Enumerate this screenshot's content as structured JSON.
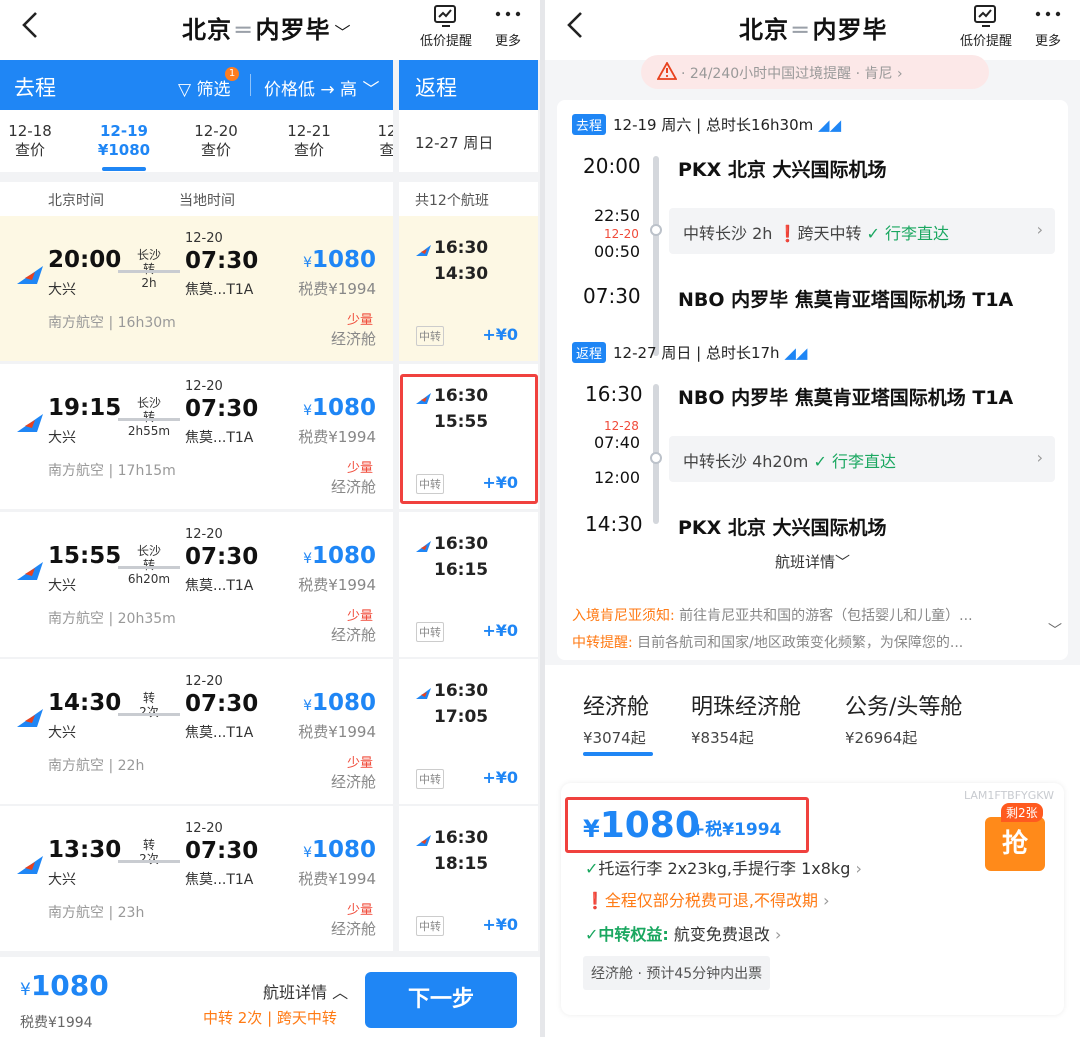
{
  "left": {
    "title_from": "北京",
    "title_to": "内罗毕",
    "btn_alert": "低价提醒",
    "btn_more": "更多",
    "outbound_label": "去程",
    "filter_label": "筛选",
    "filter_count": "1",
    "sort_label": "价格低 → 高",
    "return_label": "返程",
    "dates": [
      {
        "date": "12-18",
        "sub": "查价"
      },
      {
        "date": "12-19",
        "sub": "¥1080"
      },
      {
        "date": "12-20",
        "sub": "查价"
      },
      {
        "date": "12-21",
        "sub": "查价"
      },
      {
        "date": "12",
        "sub": "查"
      }
    ],
    "return_date": "12-27 周日",
    "col_beijing": "北京时间",
    "col_local": "当地时间",
    "return_count": "共12个航班",
    "flights": [
      {
        "dep": "20:00",
        "dep_ap": "大兴",
        "via": "长沙",
        "via2": "转",
        "dur": "2h",
        "arr_date": "12-20",
        "arr": "07:30",
        "arr_ap": "焦莫...T1A",
        "price": "1080",
        "tax": "税费¥1994",
        "airline": "南方航空",
        "total": "16h30m",
        "seat": "少量",
        "cabin": "经济舱",
        "r_dep": "16:30",
        "r_arr": "14:30",
        "r_tag": "中转",
        "r_add": "+¥0"
      },
      {
        "dep": "19:15",
        "dep_ap": "大兴",
        "via": "长沙",
        "via2": "转",
        "dur": "2h55m",
        "arr_date": "12-20",
        "arr": "07:30",
        "arr_ap": "焦莫...T1A",
        "price": "1080",
        "tax": "税费¥1994",
        "airline": "南方航空",
        "total": "17h15m",
        "seat": "少量",
        "cabin": "经济舱",
        "r_dep": "16:30",
        "r_arr": "15:55",
        "r_tag": "中转",
        "r_add": "+¥0"
      },
      {
        "dep": "15:55",
        "dep_ap": "大兴",
        "via": "长沙",
        "via2": "转",
        "dur": "6h20m",
        "arr_date": "12-20",
        "arr": "07:30",
        "arr_ap": "焦莫...T1A",
        "price": "1080",
        "tax": "税费¥1994",
        "airline": "南方航空",
        "total": "20h35m",
        "seat": "少量",
        "cabin": "经济舱",
        "r_dep": "16:30",
        "r_arr": "16:15",
        "r_tag": "中转",
        "r_add": "+¥0"
      },
      {
        "dep": "14:30",
        "dep_ap": "大兴",
        "via": "",
        "via2": "转",
        "dur": "2次",
        "arr_date": "12-20",
        "arr": "07:30",
        "arr_ap": "焦莫...T1A",
        "price": "1080",
        "tax": "税费¥1994",
        "airline": "南方航空",
        "total": "22h",
        "seat": "少量",
        "cabin": "经济舱",
        "r_dep": "16:30",
        "r_arr": "17:05",
        "r_tag": "中转",
        "r_add": "+¥0"
      },
      {
        "dep": "13:30",
        "dep_ap": "大兴",
        "via": "",
        "via2": "转",
        "dur": "2次",
        "arr_date": "12-20",
        "arr": "07:30",
        "arr_ap": "焦莫...T1A",
        "price": "1080",
        "tax": "税费¥1994",
        "airline": "南方航空",
        "total": "23h",
        "seat": "少量",
        "cabin": "经济舱",
        "r_dep": "16:30",
        "r_arr": "18:15",
        "r_tag": "中转",
        "r_add": "+¥0"
      }
    ],
    "bottom_price": "1080",
    "bottom_tax": "税费¥1994",
    "bottom_detail": "航班详情",
    "bottom_meta": "中转 2次 | 跨天中转",
    "next_btn": "下一步"
  },
  "right": {
    "title_from": "北京",
    "title_to": "内罗毕",
    "btn_alert": "低价提醒",
    "btn_more": "更多",
    "notice": "· 24/240小时中国过境提醒 · 肯尼",
    "out_tag": "去程",
    "out_hdr": "12-19 周六 | 总时长16h30m",
    "out_dep": "20:00",
    "out_dep_ap": "PKX 北京 大兴国际机场",
    "out_t1": "22:50",
    "out_tdate": "12-20",
    "out_t2": "00:50",
    "out_transfer_a": "中转长沙 2h",
    "out_transfer_b": "跨天中转",
    "out_transfer_c": "行李直达",
    "out_arr": "07:30",
    "out_arr_ap": "NBO 内罗毕 焦莫肯亚塔国际机场 T1A",
    "ret_tag": "返程",
    "ret_hdr": "12-27 周日 | 总时长17h",
    "ret_dep": "16:30",
    "ret_dep_ap": "NBO 内罗毕 焦莫肯亚塔国际机场 T1A",
    "ret_tdate": "12-28",
    "ret_t1": "07:40",
    "ret_t2": "12:00",
    "ret_transfer_a": "中转长沙 4h20m",
    "ret_transfer_c": "行李直达",
    "ret_arr": "14:30",
    "ret_arr_ap": "PKX 北京 大兴国际机场",
    "flight_detail": "航班详情",
    "note1_key": "入境肯尼亚须知:",
    "note1": "前往肯尼亚共和国的游客（包括婴儿和儿童）...",
    "note2_key": "中转提醒:",
    "note2": "目前各航司和国家/地区政策变化频繁，为保障您的...",
    "cabins": [
      {
        "name": "经济舱",
        "price": "¥3074起"
      },
      {
        "name": "明珠经济舱",
        "price": "¥8354起"
      },
      {
        "name": "公务/头等舱",
        "price": "¥26964起"
      }
    ],
    "fare_code": "LAM1FTBFYGKW",
    "fare_price": "1080",
    "fare_tax": "+税¥1994",
    "grab_tag": "剩2张",
    "grab": "抢",
    "line1": "托运行李 2x23kg,手提行李 1x8kg",
    "line2": "全程仅部分税费可退,不得改期",
    "line3_key": "中转权益:",
    "line3": "航变免费退改",
    "chip": "经济舱 · 预计45分钟内出票"
  },
  "colors": {
    "accent": "#1f86f5",
    "highlight": "#f0413e",
    "orange": "#ff7a14",
    "green": "#1aa760"
  },
  "icons": [
    "back-chevron-icon",
    "price-alert-icon",
    "more-dots-icon",
    "filter-icon",
    "airline-logo-icon",
    "warning-icon",
    "check-icon"
  ]
}
